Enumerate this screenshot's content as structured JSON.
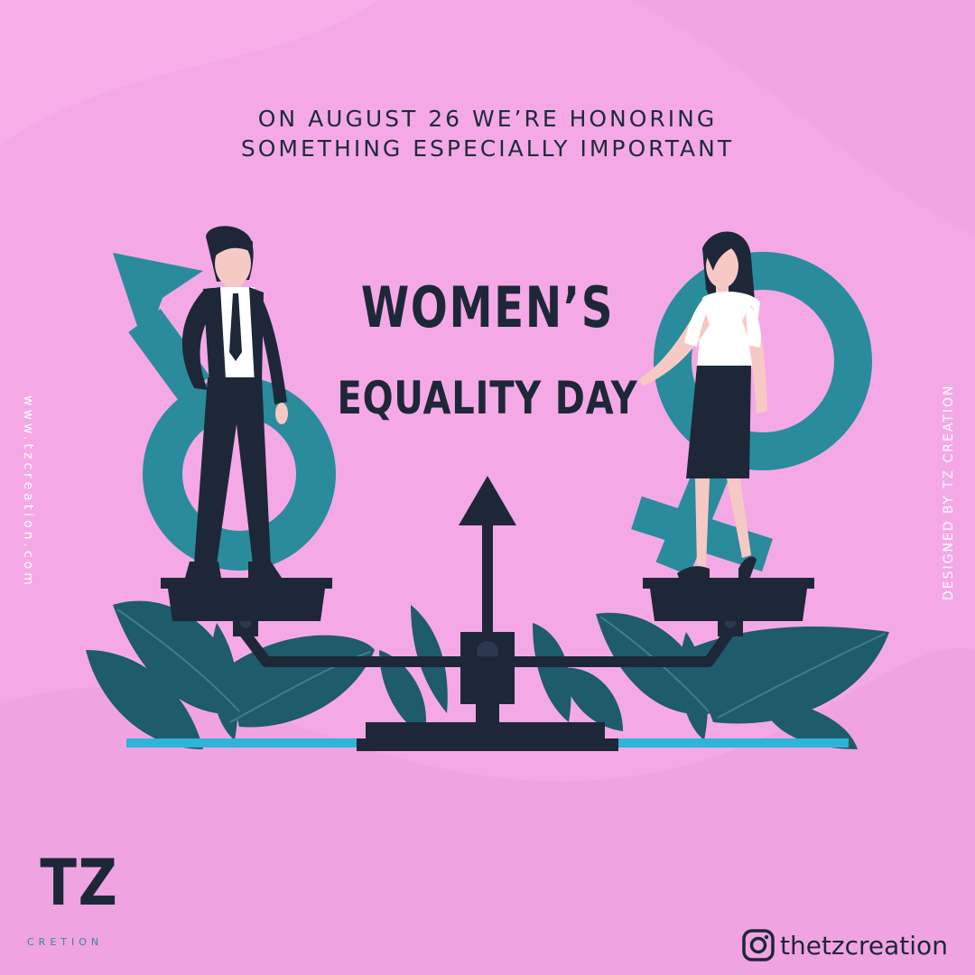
{
  "headline": {
    "line1": "ON AUGUST 26 WE’RE HONORING",
    "line2": "SOMETHING ESPECIALLY IMPORTANT"
  },
  "title": {
    "line1": "WOMEN’S",
    "line2": "EQUALITY DAY"
  },
  "side_left": {
    "website": "www.tzcreation.com"
  },
  "side_right": {
    "designed_by": "DESIGNED BY  TZ CREATION"
  },
  "logo": {
    "main": "TZ",
    "sub": "CRETION"
  },
  "social": {
    "icon": "instagram-icon",
    "handle": "thetzcreation"
  },
  "colors": {
    "background": "#f3a8e4",
    "symbol_teal": "#2a8b9c",
    "dark_navy": "#1d2738",
    "leaf_teal": "#1e5b6b",
    "ground_line": "#2db4d6"
  }
}
